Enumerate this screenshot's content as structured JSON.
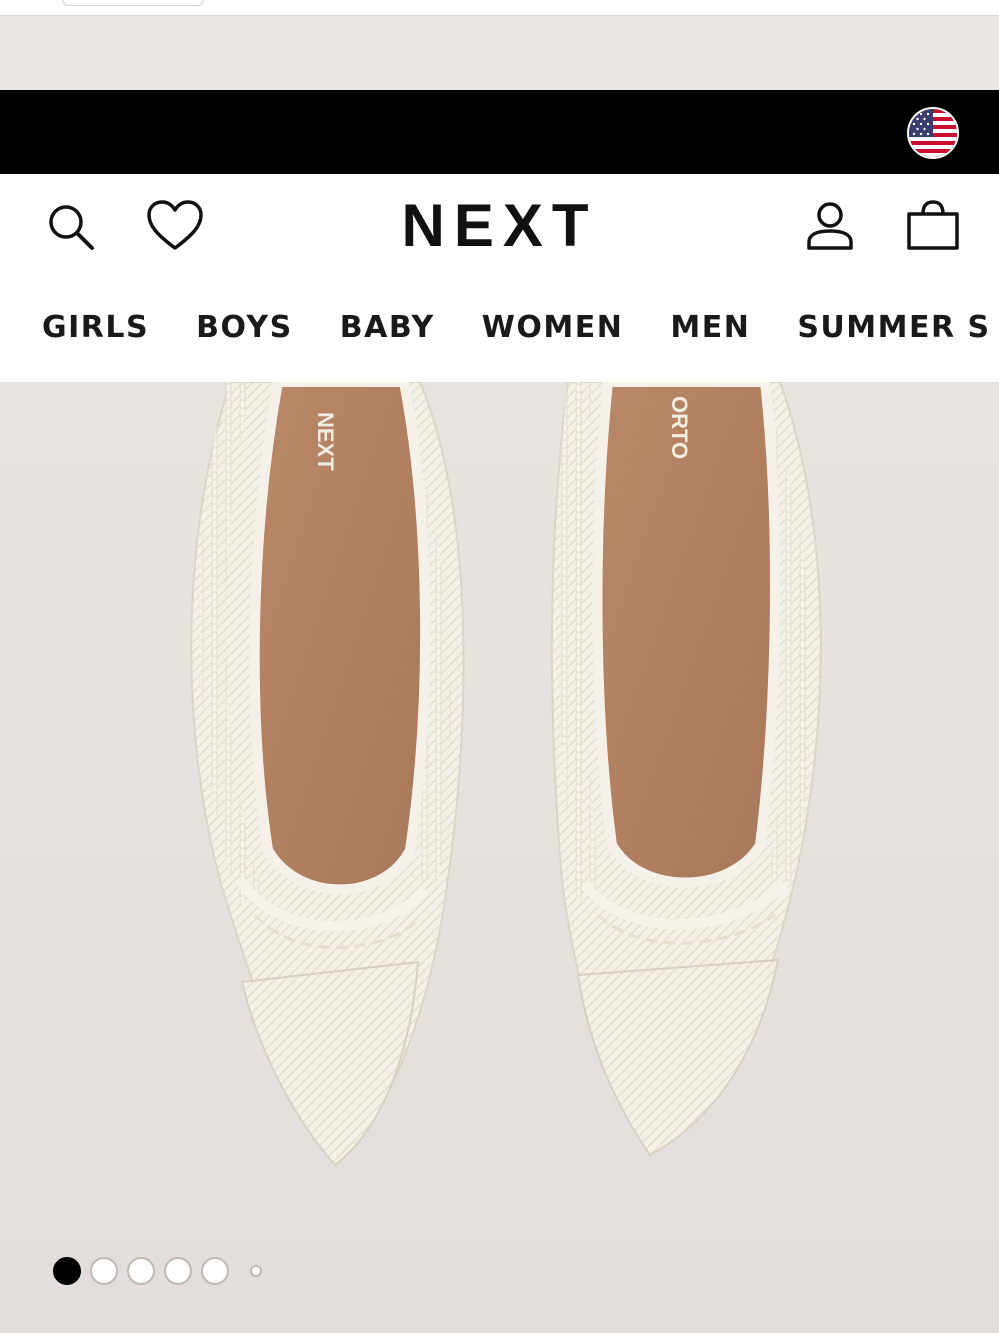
{
  "header": {
    "logo": "NEXT",
    "icons": {
      "search": "search-icon",
      "wishlist": "heart-icon",
      "account": "user-icon",
      "bag": "shopping-bag-icon",
      "country": "us-flag-icon"
    }
  },
  "nav": {
    "items": [
      {
        "label": "GIRLS"
      },
      {
        "label": "BOYS"
      },
      {
        "label": "BABY"
      },
      {
        "label": "WOMEN"
      },
      {
        "label": "MEN"
      },
      {
        "label": "SUMMER S"
      }
    ]
  },
  "product": {
    "insole_brand": "NEXT",
    "insole_sub": "ORTO"
  },
  "carousel": {
    "total_dots": 6,
    "active_index": 0
  },
  "colors": {
    "banner": "#000000",
    "header": "#ffffff",
    "text": "#111111",
    "background": "#e9e5e2",
    "shoe": "#f3efe6",
    "insole": "#b48362"
  }
}
